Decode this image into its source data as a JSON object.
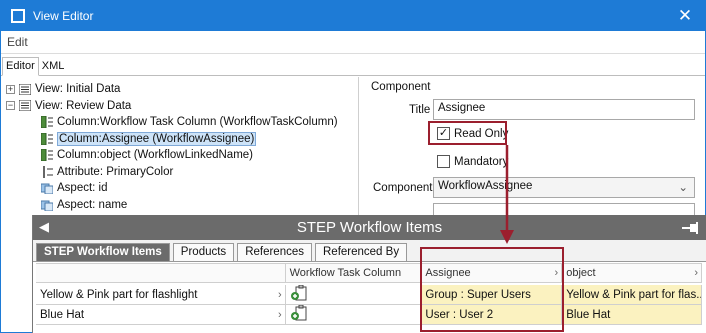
{
  "window": {
    "title": "View Editor",
    "close_glyph": "✕"
  },
  "menu": {
    "edit": "Edit"
  },
  "editor_tabs": [
    {
      "label": "Editor"
    },
    {
      "label": "XML"
    }
  ],
  "tree": {
    "items": [
      {
        "label": "View: Initial Data",
        "expander": "+"
      },
      {
        "label": "View: Review Data",
        "expander": "−"
      },
      {
        "label": "Column:Workflow Task Column (WorkflowTaskColumn)"
      },
      {
        "label": "Column:Assignee (WorkflowAssignee)"
      },
      {
        "label": "Column:object (WorkflowLinkedName)"
      },
      {
        "label": "Attribute: PrimaryColor"
      },
      {
        "label": "Aspect: id"
      },
      {
        "label": "Aspect: name"
      }
    ]
  },
  "component_panel": {
    "heading": "Component",
    "title_label": "Title",
    "title_value": "Assignee",
    "read_only_label": "Read Only",
    "read_only_checked": true,
    "mandatory_label": "Mandatory",
    "mandatory_checked": false,
    "component_label": "Component",
    "component_value": "WorkflowAssignee"
  },
  "step_panel": {
    "title": "STEP Workflow Items",
    "tabs": [
      {
        "label": "STEP Workflow Items"
      },
      {
        "label": "Products"
      },
      {
        "label": "References"
      },
      {
        "label": "Referenced By"
      }
    ],
    "columns": [
      "",
      "Workflow Task Column",
      "Assignee",
      "object"
    ],
    "rows": [
      {
        "name": "Yellow & Pink part for flashlight",
        "assignee": "Group : Super Users",
        "object": "Yellow & Pink part for flas..."
      },
      {
        "name": "Blue Hat",
        "assignee": "User : User 2",
        "object": "Blue Hat"
      }
    ]
  },
  "colors": {
    "accent": "#1e7bd6",
    "highlight": "#9b1f2e",
    "cell_yellow": "#fbf2c0",
    "step_header": "#6b6b6b"
  }
}
